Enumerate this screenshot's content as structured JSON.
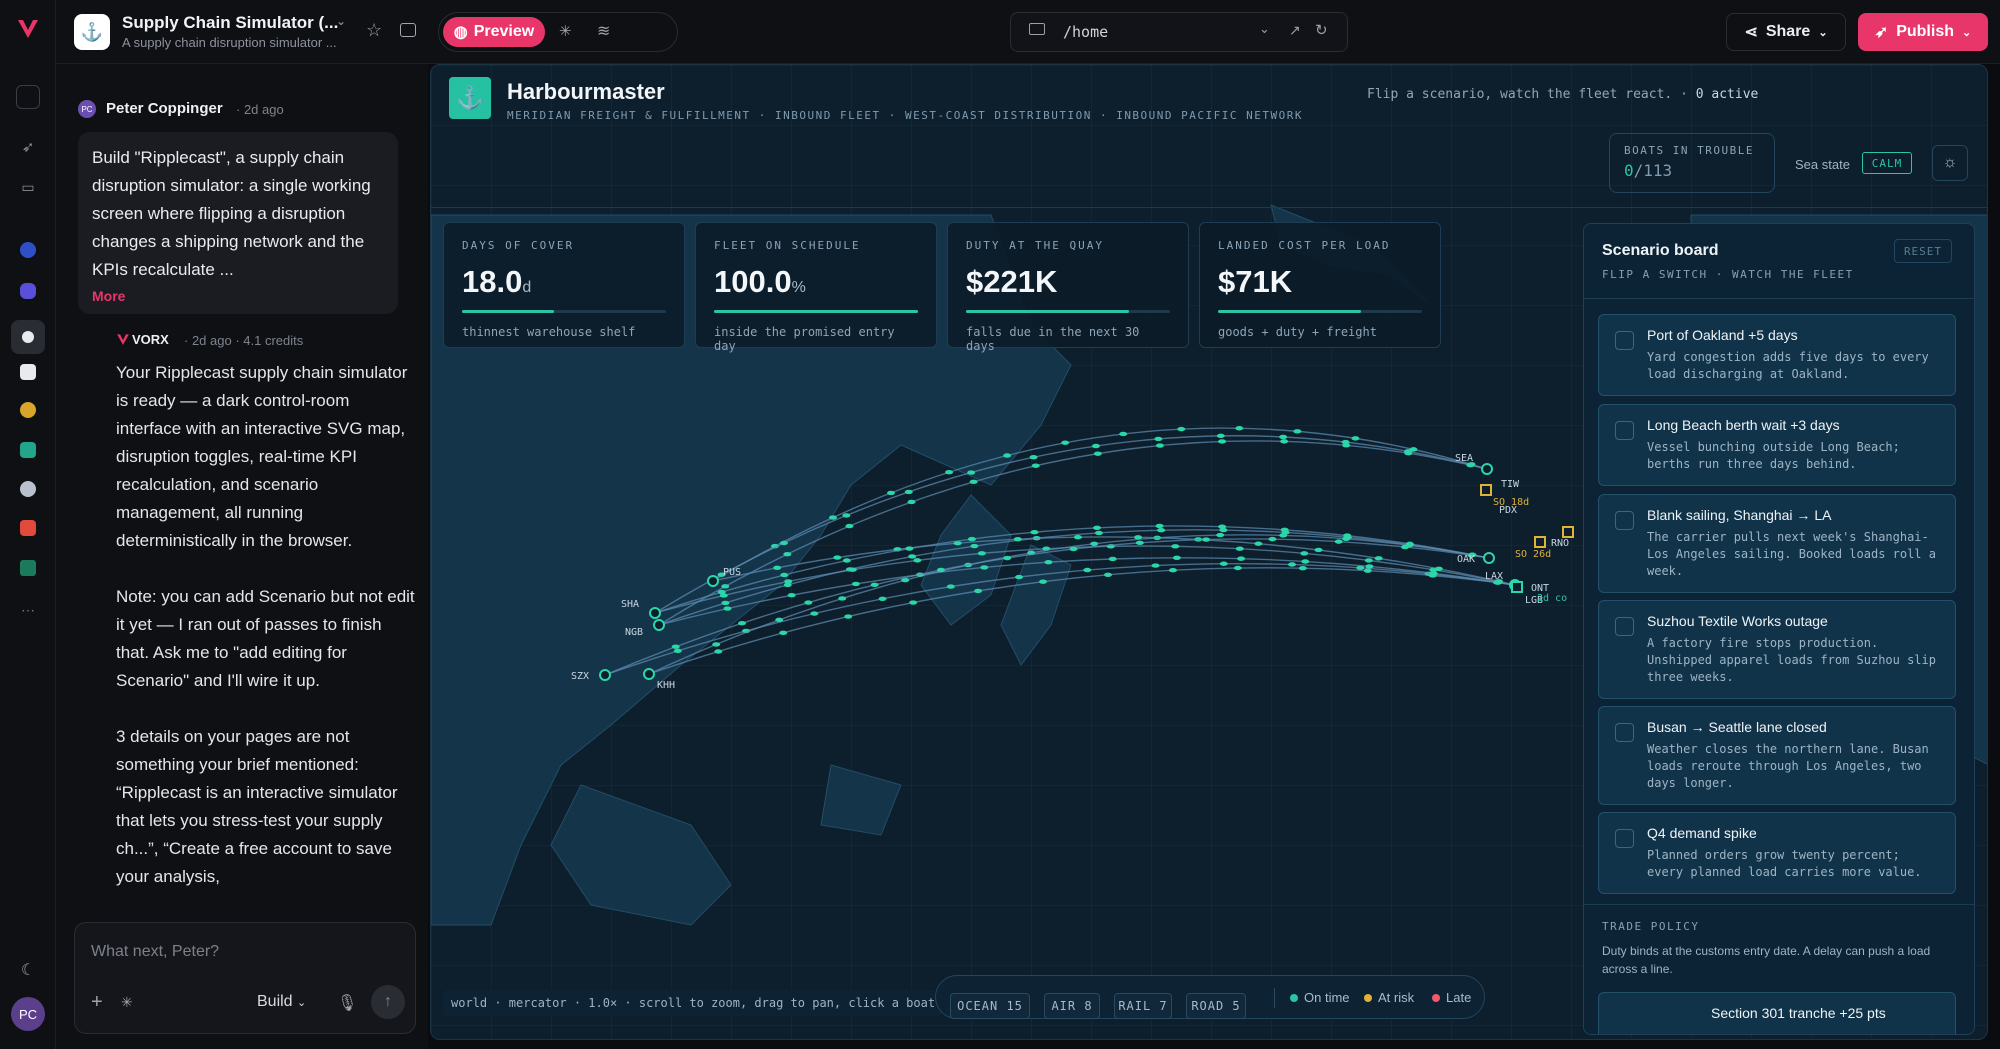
{
  "app": {
    "title": "Supply Chain Simulator (...",
    "subtitle": "A supply chain disruption simulator ...",
    "preview_label": "Preview",
    "url": "/home",
    "share_label": "Share",
    "publish_label": "Publish"
  },
  "chat": {
    "user_name": "Peter Coppinger",
    "user_initials": "PC",
    "user_time": "· 2d ago",
    "prompt": "Build \"Ripplecast\", a supply chain disruption simulator: a single working screen where flipping a disruption changes a shipping network and the KPIs recalculate ...",
    "more_label": "More",
    "bot_name": "VORX",
    "bot_meta": "· 2d ago · 4.1 credits",
    "reply_p1": "Your Ripplecast supply chain simulator is ready — a dark control-room interface with an interactive SVG map, disruption toggles, real-time KPI recalculation, and scenario management, all running deterministically in the browser.",
    "reply_p2": "Note: you can add Scenario but not edit it yet — I ran out of passes to finish that. Ask me to \"add editing for Scenario\" and I'll wire it up.",
    "reply_p3": "3 details on your pages are not something your brief mentioned: “Ripplecast is an interactive simulator that lets you stress-test your supply ch...”, “Create a free account to save your analysis,",
    "input_placeholder": "What next, Peter?",
    "build_label": "Build"
  },
  "header": {
    "title": "Harbourmaster",
    "subtitle": "MERIDIAN FREIGHT & FULFILLMENT · INBOUND FLEET · WEST-COAST DISTRIBUTION · INBOUND PACIFIC NETWORK",
    "hint": "Flip a scenario, watch the fleet react. ·",
    "active": "0 active",
    "trouble_label": "BOATS IN TROUBLE",
    "trouble_value": "0",
    "trouble_total": "/113",
    "sea_label": "Sea state",
    "sea_value": "CALM"
  },
  "kpis": [
    {
      "label": "DAYS OF COVER",
      "value": "18.0",
      "unit": "d",
      "sub": "thinnest warehouse shelf",
      "fill": 0.45
    },
    {
      "label": "FLEET ON SCHEDULE",
      "value": "100.0",
      "unit": "%",
      "sub": "inside the promised entry day",
      "fill": 1.0
    },
    {
      "label": "DUTY AT THE QUAY",
      "value": "$221K",
      "unit": "",
      "sub": "falls due in the next 30 days",
      "fill": 0.8
    },
    {
      "label": "LANDED COST PER LOAD",
      "value": "$71K",
      "unit": "",
      "sub": "goods + duty + freight",
      "fill": 0.7
    }
  ],
  "board": {
    "title": "Scenario board",
    "subtitle": "FLIP A SWITCH · WATCH THE FLEET",
    "reset": "RESET",
    "scenarios": [
      {
        "title": "Port of Oakland +5 days",
        "desc": "Yard congestion adds five days to every load discharging at Oakland."
      },
      {
        "title": "Long Beach berth wait +3 days",
        "desc": "Vessel bunching outside Long Beach; berths run three days behind."
      },
      {
        "title": "Blank sailing, Shanghai → LA",
        "desc": "The carrier pulls next week's Shanghai-Los Angeles sailing. Booked loads roll a week."
      },
      {
        "title": "Suzhou Textile Works outage",
        "desc": "A factory fire stops production. Unshipped apparel loads from Suzhou slip three weeks."
      },
      {
        "title": "Busan → Seattle lane closed",
        "desc": "Weather closes the northern lane. Busan loads reroute through Los Angeles, two days longer."
      },
      {
        "title": "Q4 demand spike",
        "desc": "Planned orders grow twenty percent; every planned load carries more value."
      }
    ],
    "policy_label": "TRADE POLICY",
    "policy_desc": "Duty binds at the customs entry date. A delay can push a load across a line.",
    "policy_next": "Section 301 tranche +25 pts"
  },
  "map": {
    "footer": "world · mercator · 1.0× · scroll to zoom, drag to pan, click a boat",
    "ports_asia": [
      "SHA",
      "NGB",
      "SZX",
      "KHH",
      "PUS"
    ],
    "ports_us": [
      "SEA",
      "TIW",
      "PDX",
      "OAK",
      "LAX",
      "LGB",
      "ONT",
      "RNO"
    ],
    "so_labels": [
      "SO 18d",
      "SO 26d",
      "2d co"
    ]
  },
  "legend": {
    "chips": [
      "OCEAN 15",
      "AIR 8",
      "RAIL 7",
      "ROAD 5"
    ],
    "on_time": "On time",
    "at_risk": "At risk",
    "late": "Late"
  },
  "colors": {
    "accent": "#2bc4a6",
    "publish": "#e8366a",
    "warn": "#e0b23a",
    "late": "#ef5a6f"
  }
}
